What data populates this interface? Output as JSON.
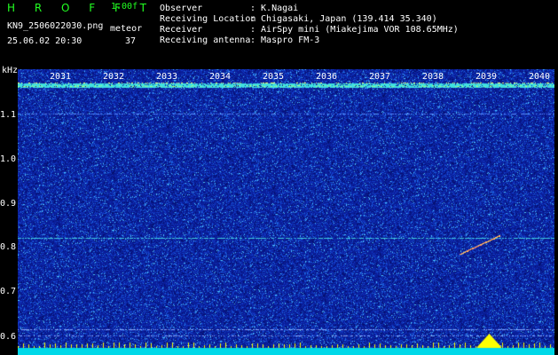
{
  "header": {
    "brand": "H R O F F T",
    "version": "1.00f",
    "filename": "KN9_2506022030.png",
    "meteor_label": "meteor",
    "datetime": "25.06.02 20:30",
    "count": "37"
  },
  "meta": [
    {
      "key": "Observer",
      "value": ": K.Nagai"
    },
    {
      "key": "Receiving Location",
      "value": ": Chigasaki, Japan (139.414 35.340)"
    },
    {
      "key": "Receiver",
      "value": ": AirSpy mini (Miakejima VOR 108.65MHz)"
    },
    {
      "key": "Receiving antenna",
      "value": ": Maspro FM-3"
    }
  ],
  "axis": {
    "y_unit": "kHz",
    "y_ticks": [
      "1.1",
      "1.0",
      "0.9",
      "0.8",
      "0.7",
      "0.6"
    ],
    "x_ticks": [
      "2031",
      "2032",
      "2033",
      "2034",
      "2035",
      "2036",
      "2037",
      "2038",
      "2039",
      "2040"
    ]
  },
  "colors": {
    "background": "#0a1e9a",
    "noise_low": "#1030c8",
    "noise_high": "#40c0ff",
    "signal": "#00e0e0",
    "meteor": "#ff8060",
    "yellow": "#ffff00"
  }
}
